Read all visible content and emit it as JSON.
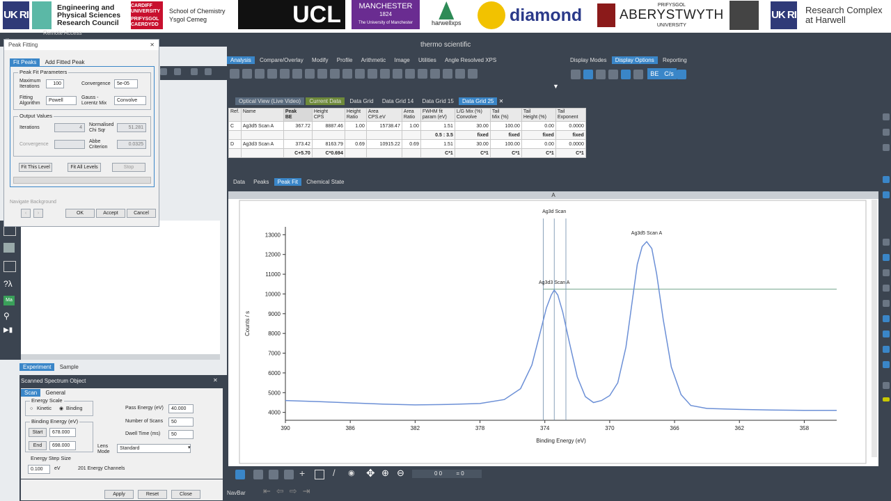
{
  "banner": {
    "ukri1": "UK RI",
    "epsrc": [
      "Engineering and",
      "Physical Sciences",
      "Research Council"
    ],
    "cardiff_top": "CARDIFF UNIVERSITY",
    "cardiff_bot": "PRIFYSGOL CAERDYDD",
    "chem": [
      "School of Chemistry",
      "Ysgol Cemeg"
    ],
    "ucl": "UCL",
    "manchester": "MANCHESTER",
    "manchester_year": "1824",
    "manchester_sub": "The University of Manchester",
    "harwell": "harwellxps",
    "diamond": "diamond",
    "aber_top": "PRIFYSGOL",
    "aber": "ABERYSTWYTH",
    "aber_bot": "UNIVERSITY",
    "ukri2": "UK RI",
    "rch": [
      "Research Complex",
      "at Harwell"
    ]
  },
  "app": {
    "remote_access": "Remote Access",
    "brand": "thermo scientific",
    "ribbon_tabs": [
      "Analysis",
      "Compare/Overlay",
      "Modify",
      "Profile",
      "Arithmetic",
      "Image",
      "Utilities",
      "Angle Resolved XPS"
    ],
    "right_tabs": [
      "Display Modes",
      "Display Options",
      "Reporting"
    ],
    "be_btn": "BE",
    "cs_btn": "C/s",
    "view_tabs": [
      "Optical View (Live Video)",
      "Current Data",
      "Data Grid",
      "Data Grid 14",
      "Data Grid 15",
      "Data Grid 25"
    ],
    "bottom_tabs": [
      "Data",
      "Peaks",
      "Peak Fit",
      "Chemical State"
    ],
    "plot_header": "A",
    "navbar": "NavBar",
    "coords": [
      "0 0",
      "= 0"
    ]
  },
  "grid": {
    "headers": [
      [
        "Ref.",
        ""
      ],
      [
        "Name",
        ""
      ],
      [
        "Peak",
        "BE"
      ],
      [
        "Height",
        "CPS"
      ],
      [
        "Height",
        "Ratio"
      ],
      [
        "Area",
        "CPS.eV"
      ],
      [
        "Area",
        "Ratio"
      ],
      [
        "FWHM fit",
        "param (eV)"
      ],
      [
        "L/G Mix (%)",
        "Convolve"
      ],
      [
        "Tail",
        "Mix (%)"
      ],
      [
        "Tail",
        "Height (%)"
      ],
      [
        "Tail",
        "Exponent"
      ]
    ],
    "rows": [
      [
        "C",
        "Ag3d5 Scan A",
        "367.72",
        "8887.46",
        "1.00",
        "15738.47",
        "1.00",
        "1.51",
        "30.00",
        "100.00",
        "0.00",
        "0.0000"
      ],
      [
        "",
        "",
        "",
        "",
        "",
        "",
        "",
        "0.5 : 3.5",
        "fixed",
        "fixed",
        "fixed",
        "fixed"
      ],
      [
        "D",
        "Ag3d3 Scan A",
        "373.42",
        "8163.79",
        "0.69",
        "10915.22",
        "0.69",
        "1.51",
        "30.00",
        "100.00",
        "0.00",
        "0.0000"
      ],
      [
        "",
        "",
        "C+5.70",
        "C*0.694",
        "",
        "",
        "",
        "C*1",
        "C*1",
        "C*1",
        "C*1",
        "C*1"
      ]
    ]
  },
  "peak_fitting": {
    "title": "Peak Fitting",
    "tabs": [
      "Fit Peaks",
      "Add Fitted Peak"
    ],
    "params_group": "Peak Fit Parameters",
    "max_iter_label": "Maximum Iterations",
    "max_iter": "100",
    "convergence_label": "Convergence",
    "convergence": "5e-05",
    "fitting_algo_label": "Fitting Algorithm",
    "fitting_algo": "Powell",
    "gl_mix_label": "Gauss - Lorentz Mix",
    "gl_mix": "Convolve",
    "output_group": "Output Values",
    "iterations_label": "Iterations",
    "iterations": "4",
    "chi_label": "Normalised Chi Sqr",
    "chi": "51.281",
    "conv_out_label": "Convergence",
    "abbe_label": "Abbe Criterion",
    "abbe": "0.0325",
    "fit_this": "Fit This Level",
    "fit_all": "Fit All Levels",
    "stop": "Stop",
    "nav_bg": "Navigate Background",
    "ok": "OK",
    "accept": "Accept",
    "cancel": "Cancel"
  },
  "experiment_tabs": [
    "Experiment",
    "Sample"
  ],
  "scanned": {
    "title": "Scanned Spectrum Object",
    "tabs": [
      "Scan",
      "General"
    ],
    "energy_scale": "Energy Scale",
    "kinetic": "Kinetic",
    "binding": "Binding",
    "binding_energy": "Binding Energy (eV)",
    "start_label": "Start",
    "start": "678.000",
    "end_label": "End",
    "end": "698.000",
    "pass_energy_label": "Pass Energy (eV)",
    "pass_energy": "40.000",
    "num_scans_label": "Number of Scans",
    "num_scans": "50",
    "dwell_label": "Dwell Time (ms)",
    "dwell": "50",
    "lens_label": "Lens Mode",
    "lens": "Standard",
    "step_group": "Energy Step Size",
    "step": "0.100",
    "step_unit": "eV",
    "channels": "201 Energy Channels",
    "apply": "Apply",
    "reset": "Reset",
    "close": "Close"
  },
  "chart_data": {
    "type": "line",
    "title": "Ag3d Scan",
    "xlabel": "Binding Energy (eV)",
    "ylabel": "Counts / s",
    "xlim": [
      390,
      356
    ],
    "ylim": [
      3600,
      13400
    ],
    "x_ticks": [
      390,
      386,
      382,
      378,
      374,
      370,
      366,
      362,
      358
    ],
    "y_ticks": [
      4000,
      5000,
      6000,
      7000,
      8000,
      9000,
      10000,
      11000,
      12000,
      13000
    ],
    "peak_labels": [
      {
        "text": "Ag3d3 Scan A",
        "x": 373.42,
        "y": 10300
      },
      {
        "text": "Ag3d5 Scan A",
        "x": 367.72,
        "y": 12800
      }
    ],
    "background_level": 10250,
    "region_markers_x": [
      374.1,
      373.42,
      372.7
    ],
    "series": [
      {
        "color": "#6b8fd6",
        "x": [
          390,
          388,
          386,
          384,
          382,
          380,
          378,
          376.5,
          375.5,
          374.8,
          374.3,
          373.9,
          373.6,
          373.42,
          373.2,
          372.9,
          372.5,
          372.0,
          371.5,
          371.0,
          370.5,
          370.0,
          369.5,
          369.0,
          368.6,
          368.3,
          368.0,
          367.72,
          367.4,
          367.1,
          366.7,
          366.2,
          365.6,
          365.0,
          364.0,
          362.0,
          360.0,
          358.0,
          356.0
        ],
        "values": [
          4600,
          4550,
          4480,
          4420,
          4380,
          4400,
          4450,
          4650,
          5200,
          6400,
          8000,
          9300,
          9950,
          10200,
          9950,
          9100,
          7600,
          5800,
          4800,
          4500,
          4600,
          4850,
          5500,
          7300,
          9700,
          11500,
          12400,
          12650,
          12300,
          11000,
          8700,
          6300,
          4900,
          4350,
          4200,
          4150,
          4120,
          4100,
          4100
        ]
      }
    ]
  }
}
